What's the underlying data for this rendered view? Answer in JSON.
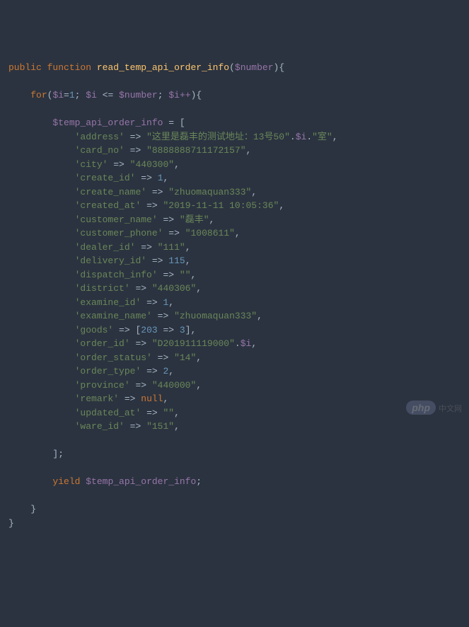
{
  "code": {
    "line1": {
      "public": "public",
      "function": "function",
      "fn": "read_temp_api_order_info",
      "param": "$number"
    },
    "line2": {
      "for": "for",
      "i": "$i",
      "one": "1",
      "le": "<=",
      "num": "$number",
      "inc": "$i++"
    },
    "assign": {
      "var": "$temp_api_order_info"
    },
    "rows": [
      {
        "key": "'address'",
        "val": "\"这里是磊丰的测试地址：13号50\"",
        "concat1": ".",
        "v2": "$i",
        "concat2": ".",
        "v3": "\"室\""
      },
      {
        "key": "'card_no'",
        "val": "\"8888888711172157\""
      },
      {
        "key": "'city'",
        "val": "\"440300\""
      },
      {
        "key": "'create_id'",
        "num": "1"
      },
      {
        "key": "'create_name'",
        "val": "\"zhuomaquan333\""
      },
      {
        "key": "'created_at'",
        "val": "\"2019-11-11 10:05:36\""
      },
      {
        "key": "'customer_name'",
        "val": "\"磊丰\""
      },
      {
        "key": "'customer_phone'",
        "val": "\"1008611\""
      },
      {
        "key": "'dealer_id'",
        "val": "\"111\""
      },
      {
        "key": "'delivery_id'",
        "num": "115"
      },
      {
        "key": "'dispatch_info'",
        "val": "\"\""
      },
      {
        "key": "'district'",
        "val": "\"440306\""
      },
      {
        "key": "'examine_id'",
        "num": "1"
      },
      {
        "key": "'examine_name'",
        "val": "\"zhuomaquan333\""
      },
      {
        "key": "'goods'",
        "goods_k": "203",
        "goods_v": "3"
      },
      {
        "key": "'order_id'",
        "val": "\"D201911119000\"",
        "concat1": ".",
        "v2": "$i"
      },
      {
        "key": "'order_status'",
        "val": "\"14\""
      },
      {
        "key": "'order_type'",
        "num": "2"
      },
      {
        "key": "'province'",
        "val": "\"440000\""
      },
      {
        "key": "'remark'",
        "null": "null"
      },
      {
        "key": "'updated_at'",
        "val": "\"\""
      },
      {
        "key": "'ware_id'",
        "val": "\"151\""
      }
    ],
    "yield": {
      "kw": "yield",
      "var": "$temp_api_order_info"
    }
  },
  "watermark": {
    "php": "php",
    "cn": "中文网"
  }
}
